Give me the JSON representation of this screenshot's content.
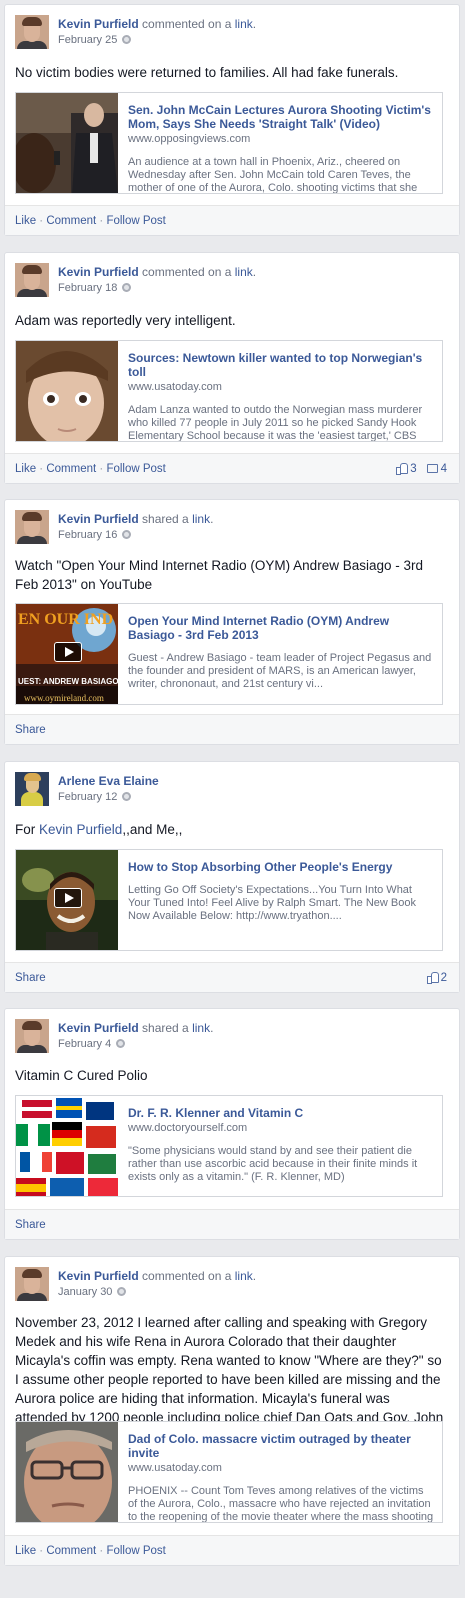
{
  "posts": [
    {
      "author": "Kevin Purfield",
      "verb": "commented on a",
      "object": "link",
      "date": "February 25",
      "message": "No victim bodies were returned to families. All had fake funerals.",
      "share": {
        "title": "Sen. John McCain Lectures Aurora Shooting Victim's Mom, Says She Needs 'Straight Talk' (Video)",
        "domain": "www.opposingviews.com",
        "description": "An audience at a town hall in Phoenix, Ariz., cheered on Wednesday after Sen. John McCain told Caren Teves, the mother of one of the Aurora, Colo. shooting victims that she needed to ...",
        "thumb_icon": "mccain-townhall-photo"
      },
      "actions": [
        "Like",
        "Comment",
        "Follow Post"
      ]
    },
    {
      "author": "Kevin Purfield",
      "verb": "commented on a",
      "object": "link",
      "date": "February 18",
      "message": "Adam was reportedly very intelligent.",
      "share": {
        "title": "Sources: Newtown killer wanted to top Norwegian's toll",
        "domain": "www.usatoday.com",
        "description": "Adam Lanza wanted to outdo the Norwegian mass murderer who killed 77 people in July 2011 so he picked Sandy Hook Elementary School because it was the 'easiest target,' CBS News reported.",
        "thumb_icon": "adam-lanza-photo"
      },
      "actions": [
        "Like",
        "Comment",
        "Follow Post"
      ],
      "likes": "3",
      "comments": "4"
    },
    {
      "author": "Kevin Purfield",
      "verb": "shared a",
      "object": "link",
      "date": "February 16",
      "message": "Watch \"Open Your Mind Internet Radio (OYM) Andrew Basiago - 3rd Feb 2013\" on YouTube",
      "share": {
        "title": "Open Your Mind Internet Radio (OYM) Andrew Basiago - 3rd Feb 2013",
        "domain": "",
        "description": "Guest - Andrew Basiago - team leader of Project Pegasus and the founder and president of MARS, is an American lawyer, writer, chrononaut, and 21st century vi...",
        "thumb_icon": "oym-video-thumbnail",
        "thumb_text_top": "EN OUR IND",
        "thumb_text_bottom": "UEST: ANDREW BASIAGO",
        "thumb_text_url": "www.oymireland.com"
      },
      "actions": [
        "Share"
      ]
    },
    {
      "author": "Arlene Eva Elaine",
      "verb": "",
      "object": "",
      "date": "February 12",
      "message_prefix": "For ",
      "message_tag": "Kevin Purfield",
      "message_suffix": ",,and Me,,",
      "share": {
        "title": "How to Stop Absorbing Other People's Energy",
        "domain": "",
        "description": "Letting Go Off Society's Expectations...You Turn Into What Your Tuned Into! Feel Alive by Ralph Smart. The New Book Now Available Below: http://www.tryathon....",
        "thumb_icon": "smiling-man-video-thumbnail"
      },
      "actions": [
        "Share"
      ],
      "likes": "2"
    },
    {
      "author": "Kevin Purfield",
      "verb": "shared a",
      "object": "link",
      "date": "February 4",
      "message": "Vitamin C Cured Polio",
      "share": {
        "title": "Dr. F. R. Klenner and Vitamin C",
        "domain": "www.doctoryourself.com",
        "description": "\"Some physicians would stand by and see their patient die rather than use ascorbic acid because in their finite minds it exists only as a vitamin.\" (F. R. Klenner, MD)",
        "thumb_icon": "flags-map-image"
      },
      "actions": [
        "Share"
      ]
    },
    {
      "author": "Kevin Purfield",
      "verb": "commented on a",
      "object": "link",
      "date": "January 30",
      "message": "November 23, 2012 I learned after calling and speaking with Gregory Medek and his wife Rena in Aurora Colorado that their daughter Micayla's coffin was empty. Rena wanted to know \"Where are they?\" so I assume other people reported to have been killed are missing and the Aurora police are hiding that information. Micayla's funeral was attended by 1200 people including police chief Dan Oats and Gov. John Hickenlooper.",
      "share": {
        "title": "Dad of Colo. massacre victim outraged by theater invite",
        "domain": "www.usatoday.com",
        "description": "PHOENIX -- Count Tom Teves among relatives of the victims of the Aurora, Colo., massacre who have rejected an invitation to the reopening of the movie theater where the mass shooting took place.",
        "thumb_icon": "tom-teves-photo"
      },
      "actions": [
        "Like",
        "Comment",
        "Follow Post"
      ]
    }
  ]
}
